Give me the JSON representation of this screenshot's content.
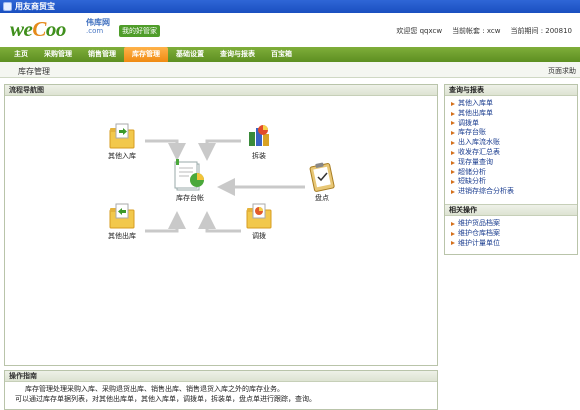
{
  "window": {
    "title": "用友商贸宝"
  },
  "header": {
    "logo_prefix": "we",
    "logo_o": "C",
    "logo_rest": "oo",
    "logo_sub": "伟库网",
    "logo_dotcom": ".com",
    "logo_badge": "我的好管家",
    "welcome": "欢迎您 qqxcw",
    "account": "当前帐套 : xcw",
    "date": "当前期间 : 200810"
  },
  "nav": {
    "items": [
      "主页",
      "采购管理",
      "销售管理",
      "库存管理",
      "基础设置",
      "查询与报表",
      "百宝箱"
    ],
    "active_index": 3
  },
  "subbar": {
    "title": "库存管理",
    "help": "页面求助"
  },
  "flow": {
    "title": "流程导航图",
    "nodes": {
      "other_in": "其他入库",
      "split": "拆装",
      "ledger": "库存台帐",
      "inventory": "盘点",
      "other_out": "其他出库",
      "transfer": "调拨"
    },
    "colors": {
      "folder": "#f2c84b",
      "folder_dark": "#d79c22",
      "line": "#c9c9c9"
    }
  },
  "query_panel": {
    "title": "查询与报表",
    "items": [
      "其他入库单",
      "其他出库单",
      "调拨单",
      "库存台账",
      "出入库流水账",
      "收发存汇总表",
      "现存量查询",
      "超储分析",
      "短缺分析",
      "进销存综合分析表"
    ]
  },
  "related_panel": {
    "title": "相关操作",
    "items": [
      "维护货品档案",
      "维护仓库档案",
      "维护计量单位"
    ]
  },
  "guide": {
    "title": "操作指南",
    "line1": "库存管理处理采购入库、采购退货出库、销售出库、销售退货入库之外的库存业务。",
    "line2": "可以通过库存单据列表，对其他出库单，其他入库单，调拨单，拆装单，盘点单进行跟踪，查询。"
  },
  "colors": {
    "nav": "#6b9d2c",
    "nav_active": "#f39a22",
    "accent_arrow": "#d4701c"
  }
}
